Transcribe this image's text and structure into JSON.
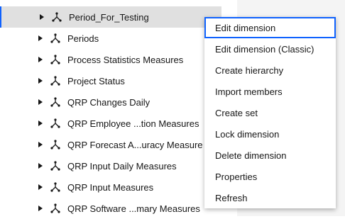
{
  "tree": {
    "items": [
      {
        "label": "Period_For_Testing",
        "icon": "dimension-icon",
        "selected": true
      },
      {
        "label": "Periods",
        "icon": "dimension-icon"
      },
      {
        "label": "Process Statistics Measures",
        "icon": "dimension-icon"
      },
      {
        "label": "Project Status",
        "icon": "dimension-icon"
      },
      {
        "label": "QRP Changes Daily",
        "icon": "dimension-icon"
      },
      {
        "label": "QRP Employee ...tion Measures",
        "icon": "dimension-icon"
      },
      {
        "label": "QRP Forecast A...uracy Measure",
        "icon": "dimension-icon"
      },
      {
        "label": "QRP Input Daily Measures",
        "icon": "dimension-icon"
      },
      {
        "label": "QRP Input Measures",
        "icon": "dimension-icon"
      },
      {
        "label": "QRP Software ...mary Measures",
        "icon": "dimension-icon"
      }
    ]
  },
  "context_menu": {
    "items": [
      {
        "label": "Edit dimension",
        "focused": true
      },
      {
        "label": "Edit dimension (Classic)"
      },
      {
        "label": "Create hierarchy"
      },
      {
        "label": "Import members"
      },
      {
        "label": "Create set"
      },
      {
        "label": "Lock dimension"
      },
      {
        "label": "Delete dimension"
      },
      {
        "label": "Properties"
      },
      {
        "label": "Refresh"
      }
    ]
  },
  "colors": {
    "accent": "#0f62fe",
    "selected_row": "#e0e0e0",
    "panel_gray": "#f4f4f4",
    "text": "#161616"
  }
}
